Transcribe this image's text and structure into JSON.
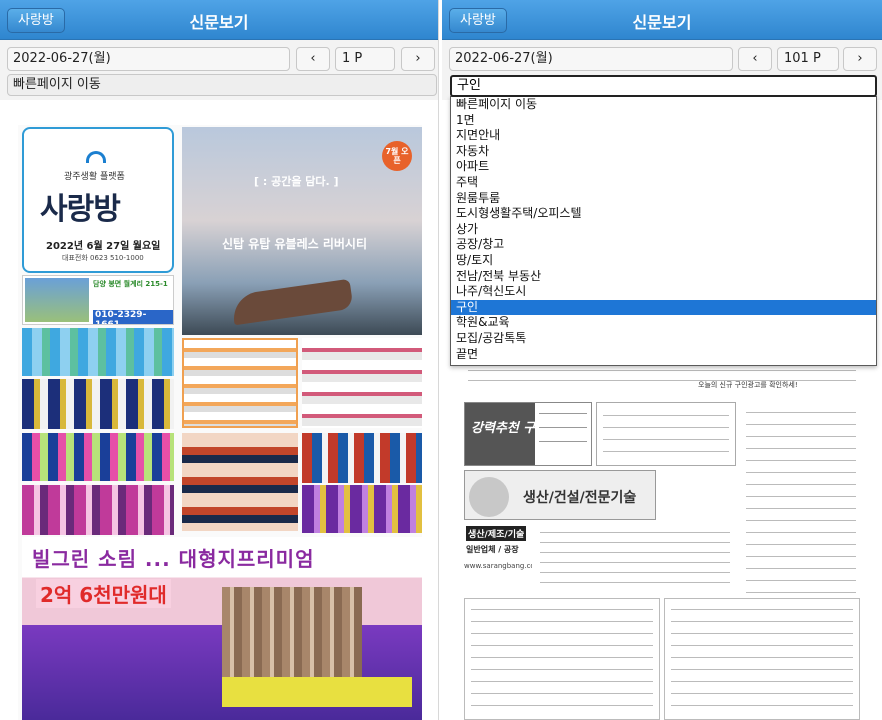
{
  "left": {
    "header": {
      "back_label": "사랑방",
      "title": "신문보기"
    },
    "date": "2022-06-27(월)",
    "page": "1 P",
    "prev": "‹",
    "next": "›",
    "quick_nav": "빠른페이지 이동",
    "cover": {
      "brand_small": "광주생활 플랫폼",
      "brand": "사랑방",
      "date_line": "2022년 6월 27일 월요일",
      "phone": "대표전화 0623 510-1000"
    },
    "ad_main": {
      "tagline": "[ : 공간을 담다. ]",
      "title": "신탑 유탑 유블레스 리버시티",
      "badge": "7월 오픈"
    },
    "ad_house": {
      "title": "담양 봉면 월계리 215-1",
      "phone": "010-2329-1661"
    },
    "bottom_ad": {
      "line1": "빌그린 소림 ... 대형지프리미엄",
      "line2": "2억 6천만원대"
    }
  },
  "right": {
    "header": {
      "back_label": "사랑방",
      "title": "신문보기"
    },
    "date": "2022-06-27(월)",
    "page": "101 P",
    "prev": "‹",
    "next": "›",
    "select_value": "구인",
    "options": [
      "빠른페이지 이동",
      "1면",
      "지면안내",
      "자동차",
      "아파트",
      "주택",
      "원룸투룸",
      "도시형생활주택/오피스텔",
      "상가",
      "공장/창고",
      "땅/토지",
      "전남/전북 부동산",
      "나주/혁신도시",
      "구인",
      "학원&교육",
      "모집/공감톡톡",
      "끝면"
    ],
    "selected_index": 13,
    "recruit_title": "강력추천 구인",
    "section_title": "생산/건설/전문기술",
    "section_sub": "생산/제조/기술",
    "section_sub2": "일반업체 / 공장",
    "site": "www.sarangbang.com",
    "notice": "오늘의 신규 구인광고를 확인하세!"
  }
}
